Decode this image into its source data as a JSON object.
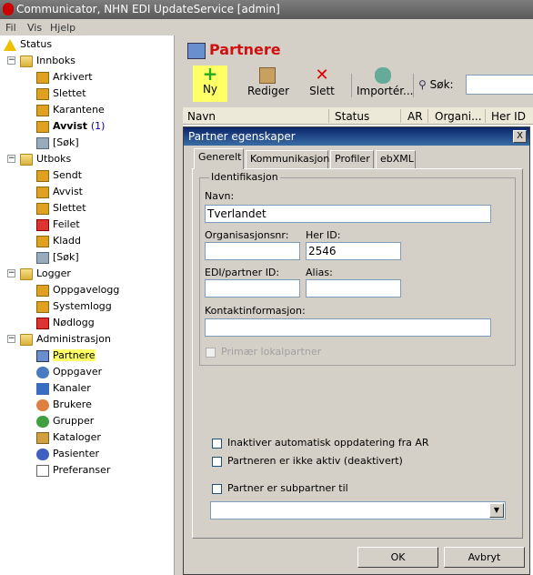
{
  "window": {
    "title": "Communicator, NHN EDI UpdateService [admin]"
  },
  "menu": [
    "Fil",
    "Vis",
    "Hjelp"
  ],
  "sidebar": {
    "status": "Status",
    "innboks": {
      "label": "Innboks",
      "items": [
        "Arkivert",
        "Slettet",
        "Karantene",
        "Avvist",
        "[Søk]"
      ],
      "avvist_count": "(1)"
    },
    "utboks": {
      "label": "Utboks",
      "items": [
        "Sendt",
        "Avvist",
        "Slettet",
        "Feilet",
        "Kladd",
        "[Søk]"
      ]
    },
    "logger": {
      "label": "Logger",
      "items": [
        "Oppgavelogg",
        "Systemlogg",
        "Nødlogg"
      ]
    },
    "admin": {
      "label": "Administrasjon",
      "items": [
        "Partnere",
        "Oppgaver",
        "Kanaler",
        "Brukere",
        "Grupper",
        "Kataloger",
        "Pasienter",
        "Preferanser"
      ]
    }
  },
  "page": {
    "title": "Partnere"
  },
  "toolbar": {
    "new": "Ny",
    "edit": "Rediger",
    "delete": "Slett",
    "import": "Importér...",
    "search": "Søk:"
  },
  "grid": {
    "columns": [
      "Navn",
      "Status",
      "AR",
      "Organi...",
      "Her ID"
    ]
  },
  "dialog": {
    "title": "Partner egenskaper",
    "close": "X",
    "tabs": [
      "Generelt",
      "Kommunikasjon",
      "Profiler",
      "ebXML"
    ],
    "group_label": "Identifikasjon",
    "fields": {
      "navn_label": "Navn:",
      "navn_value": "Tverlandet",
      "orgnr_label": "Organisasjonsnr:",
      "orgnr_value": "",
      "herid_label": "Her ID:",
      "herid_value": "2546",
      "edi_label": "EDI/partner ID:",
      "edi_value": "",
      "alias_label": "Alias:",
      "alias_value": "",
      "kontakt_label": "Kontaktinformasjon:",
      "kontakt_value": "",
      "primary_local": "Primær lokalpartner"
    },
    "checks": {
      "auto_update": "Inaktiver automatisk oppdatering fra AR",
      "inactive": "Partneren er ikke aktiv (deaktivert)",
      "subpartner": "Partner er subpartner til"
    },
    "ok": "OK",
    "cancel": "Avbryt"
  },
  "colors": {
    "highlight": "#ffff66",
    "title_red": "#d01010",
    "dialog_title": "#0a246a"
  }
}
